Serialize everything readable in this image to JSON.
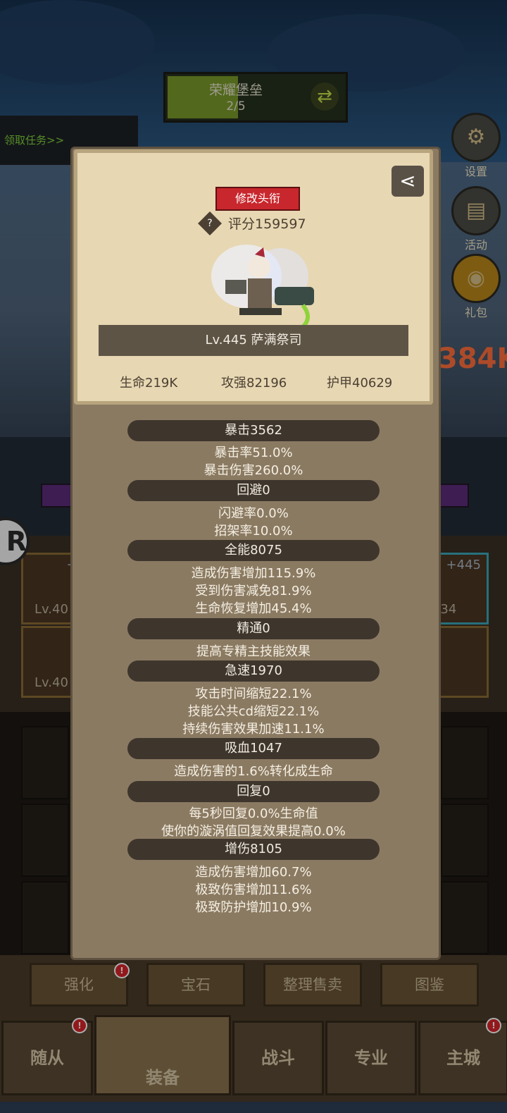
{
  "hud": {
    "stage_name": "荣耀堡垒",
    "stage_progress": "2/5",
    "quest_link": "领取任务>>",
    "side_buttons": [
      "设置",
      "活动",
      "礼包"
    ],
    "power_text": "384K",
    "r_logo": "R"
  },
  "equipment_slots": [
    {
      "plus": "+4",
      "level": "Lv.40"
    },
    {
      "plus": "+445",
      "level": "v.434"
    },
    {
      "plus": "",
      "level": "Lv.40"
    }
  ],
  "profile": {
    "change_title_button": "修改头衔",
    "help_icon": "?",
    "score": "评分159597",
    "hero_name": "Lv.445 萨满祭司",
    "life": "生命219K",
    "attack": "攻强82196",
    "armor": "护甲40629"
  },
  "stats": [
    {
      "header": "暴击3562",
      "lines": [
        "暴击率51.0%",
        "暴击伤害260.0%"
      ]
    },
    {
      "header": "回避0",
      "lines": [
        "闪避率0.0%",
        "招架率10.0%"
      ]
    },
    {
      "header": "全能8075",
      "lines": [
        "造成伤害增加115.9%",
        "受到伤害减免81.9%",
        "生命恢复增加45.4%"
      ]
    },
    {
      "header": "精通0",
      "lines": [
        "提高专精主技能效果"
      ]
    },
    {
      "header": "急速1970",
      "lines": [
        "攻击时间缩短22.1%",
        "技能公共cd缩短22.1%",
        "持续伤害效果加速11.1%"
      ]
    },
    {
      "header": "吸血1047",
      "lines": [
        "造成伤害的1.6%转化成生命"
      ]
    },
    {
      "header": "回复0",
      "lines": [
        "每5秒回复0.0%生命值",
        "使你的漩涡值回复效果提高0.0%"
      ]
    },
    {
      "header": "增伤8105",
      "lines": [
        "造成伤害增加60.7%",
        "极致伤害增加11.6%",
        "极致防护增加10.9%"
      ]
    }
  ],
  "sub_buttons": [
    "强化",
    "宝石",
    "整理售卖",
    "图鉴"
  ],
  "nav": [
    "随从",
    "装备",
    "战斗",
    "专业",
    "主城"
  ],
  "badge": "!",
  "colors": {
    "accent_red": "#c8272d",
    "panel": "#8b7a62",
    "card": "#e7d7b3"
  }
}
